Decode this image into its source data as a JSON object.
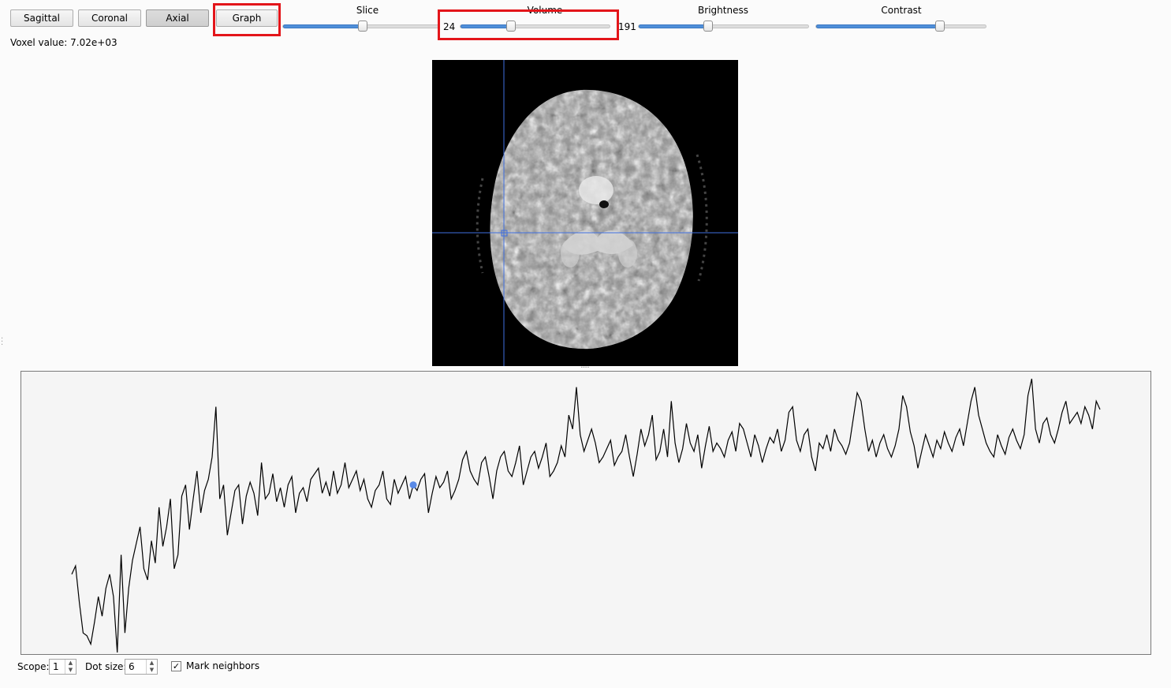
{
  "toolbar": {
    "buttons": [
      {
        "label": "Sagittal",
        "checked": false
      },
      {
        "label": "Coronal",
        "checked": false
      },
      {
        "label": "Axial",
        "checked": true
      },
      {
        "label": "Graph",
        "checked": false
      }
    ]
  },
  "sliders": {
    "slice": {
      "label": "Slice",
      "fraction": 0.51
    },
    "volume": {
      "label": "Volume",
      "min_label": "24",
      "max_label": "191",
      "fraction": 0.34
    },
    "brightness": {
      "label": "Brightness",
      "fraction": 0.41
    },
    "contrast": {
      "label": "Contrast",
      "fraction": 0.73
    }
  },
  "voxel": {
    "label": "Voxel value:",
    "value": "7.02e+03"
  },
  "controls": {
    "scope_label": "Scope:",
    "scope_value": "1",
    "dotsize_label": "Dot size:",
    "dotsize_value": "6",
    "mark_neighbors_label": "Mark neighbors",
    "mark_neighbors_checked": true,
    "check_glyph": "✓"
  },
  "graph": {
    "series": [
      0.28,
      0.31,
      0.18,
      0.07,
      0.06,
      0.03,
      0.11,
      0.2,
      0.13,
      0.23,
      0.28,
      0.2,
      0.0,
      0.35,
      0.07,
      0.23,
      0.33,
      0.39,
      0.45,
      0.3,
      0.26,
      0.4,
      0.32,
      0.52,
      0.38,
      0.45,
      0.55,
      0.3,
      0.35,
      0.56,
      0.6,
      0.44,
      0.55,
      0.65,
      0.5,
      0.58,
      0.62,
      0.7,
      0.88,
      0.55,
      0.6,
      0.42,
      0.5,
      0.58,
      0.6,
      0.46,
      0.56,
      0.61,
      0.57,
      0.49,
      0.68,
      0.55,
      0.57,
      0.64,
      0.54,
      0.59,
      0.52,
      0.6,
      0.63,
      0.5,
      0.57,
      0.59,
      0.54,
      0.62,
      0.64,
      0.66,
      0.57,
      0.61,
      0.56,
      0.65,
      0.57,
      0.6,
      0.68,
      0.59,
      0.62,
      0.65,
      0.58,
      0.62,
      0.55,
      0.52,
      0.58,
      0.6,
      0.65,
      0.55,
      0.53,
      0.62,
      0.57,
      0.6,
      0.63,
      0.55,
      0.6,
      0.58,
      0.62,
      0.64,
      0.5,
      0.57,
      0.63,
      0.59,
      0.61,
      0.65,
      0.55,
      0.58,
      0.62,
      0.69,
      0.72,
      0.65,
      0.62,
      0.6,
      0.68,
      0.7,
      0.63,
      0.55,
      0.65,
      0.7,
      0.72,
      0.65,
      0.63,
      0.68,
      0.74,
      0.6,
      0.65,
      0.7,
      0.72,
      0.66,
      0.7,
      0.75,
      0.63,
      0.65,
      0.68,
      0.74,
      0.7,
      0.85,
      0.8,
      0.95,
      0.78,
      0.72,
      0.76,
      0.8,
      0.75,
      0.68,
      0.7,
      0.73,
      0.76,
      0.67,
      0.7,
      0.72,
      0.78,
      0.7,
      0.63,
      0.71,
      0.8,
      0.74,
      0.78,
      0.85,
      0.69,
      0.72,
      0.8,
      0.7,
      0.9,
      0.75,
      0.68,
      0.73,
      0.82,
      0.75,
      0.72,
      0.78,
      0.66,
      0.74,
      0.81,
      0.72,
      0.75,
      0.73,
      0.7,
      0.76,
      0.79,
      0.72,
      0.82,
      0.8,
      0.75,
      0.7,
      0.78,
      0.74,
      0.68,
      0.73,
      0.77,
      0.75,
      0.8,
      0.72,
      0.76,
      0.86,
      0.88,
      0.76,
      0.72,
      0.78,
      0.8,
      0.7,
      0.65,
      0.75,
      0.73,
      0.78,
      0.72,
      0.8,
      0.76,
      0.74,
      0.71,
      0.75,
      0.84,
      0.93,
      0.9,
      0.8,
      0.72,
      0.76,
      0.7,
      0.75,
      0.78,
      0.73,
      0.7,
      0.74,
      0.8,
      0.92,
      0.88,
      0.79,
      0.74,
      0.66,
      0.72,
      0.78,
      0.74,
      0.7,
      0.76,
      0.73,
      0.79,
      0.75,
      0.72,
      0.77,
      0.8,
      0.74,
      0.82,
      0.9,
      0.95,
      0.85,
      0.8,
      0.75,
      0.72,
      0.7,
      0.78,
      0.74,
      0.71,
      0.77,
      0.8,
      0.76,
      0.73,
      0.78,
      0.92,
      0.98,
      0.8,
      0.75,
      0.82,
      0.84,
      0.78,
      0.75,
      0.8,
      0.86,
      0.9,
      0.82,
      0.84,
      0.86,
      0.82,
      0.88,
      0.85,
      0.8,
      0.9,
      0.87
    ]
  },
  "colors": {
    "accent": "#4f8fd9",
    "highlight": "#e3151a",
    "crosshair": "#3f6fe0",
    "marker": "#5a8ae6"
  }
}
